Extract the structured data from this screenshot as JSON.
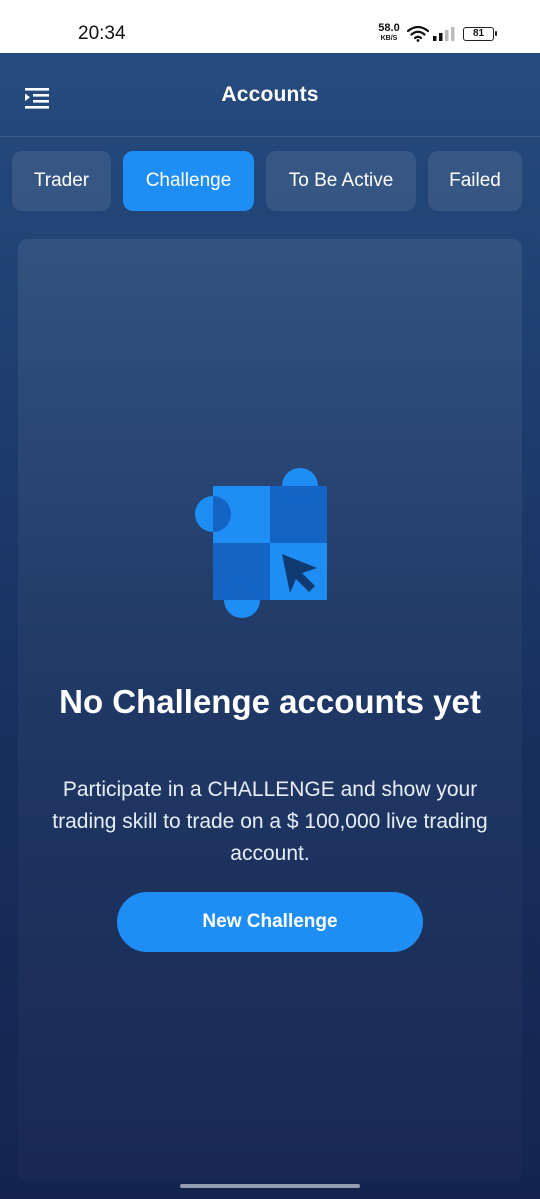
{
  "status_bar": {
    "time": "20:34",
    "net_speed_value": "58.0",
    "net_speed_unit": "KB/S",
    "battery": "81"
  },
  "header": {
    "title": "Accounts",
    "menu_icon": "menu-icon"
  },
  "tabs": [
    {
      "label": "Trader",
      "active": false
    },
    {
      "label": "Challenge",
      "active": true
    },
    {
      "label": "To Be Active",
      "active": false
    },
    {
      "label": "Failed",
      "active": false
    }
  ],
  "empty_state": {
    "icon": "puzzle-cursor-icon",
    "title": "No Challenge accounts yet",
    "description_lines": [
      "Participate in a CHALLENGE and show your",
      "trading skill to trade on a $ 100,000 live trading",
      "account."
    ],
    "button_label": "New Challenge"
  },
  "colors": {
    "accent": "#1e8ef5",
    "background_top": "#284d80",
    "background_bottom": "#14244f"
  }
}
